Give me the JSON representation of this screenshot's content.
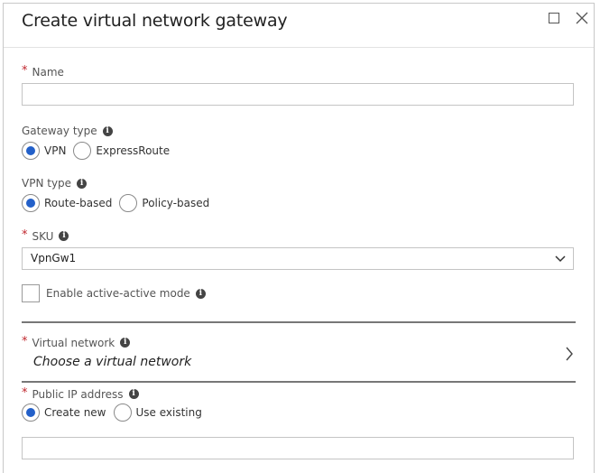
{
  "window": {
    "title": "Create virtual network gateway",
    "maximize_icon": "maximize-icon",
    "close_icon": "close-icon"
  },
  "form": {
    "name": {
      "label": "Name",
      "required": true,
      "value": "",
      "placeholder": ""
    },
    "gateway_type": {
      "label": "Gateway type",
      "options": [
        {
          "label": "VPN",
          "selected": true
        },
        {
          "label": "ExpressRoute",
          "selected": false
        }
      ]
    },
    "vpn_type": {
      "label": "VPN type",
      "options": [
        {
          "label": "Route-based",
          "selected": true
        },
        {
          "label": "Policy-based",
          "selected": false
        }
      ]
    },
    "sku": {
      "label": "SKU",
      "required": true,
      "value": "VpnGw1"
    },
    "active_active": {
      "label": "Enable active-active mode",
      "checked": false
    },
    "virtual_network": {
      "label": "Virtual network",
      "required": true,
      "value": "Choose a virtual network"
    },
    "public_ip": {
      "label": "Public IP address",
      "required": true,
      "options": [
        {
          "label": "Create new",
          "selected": true
        },
        {
          "label": "Use existing",
          "selected": false
        }
      ],
      "name_value": ""
    }
  },
  "colors": {
    "accent": "#2360c9",
    "required": "#c0272d"
  }
}
